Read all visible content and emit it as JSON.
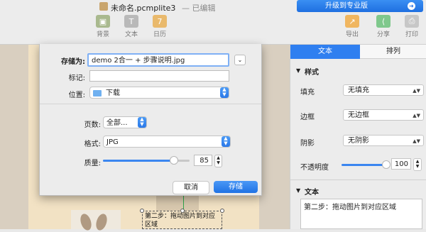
{
  "window": {
    "title": "未命名.pcmplite3",
    "edit_status": "— 已编辑",
    "upgrade_label": "升级到专业版"
  },
  "toolbar": {
    "left": [
      {
        "label": "背景",
        "icon": "background-icon"
      },
      {
        "label": "文本",
        "icon": "text-icon"
      },
      {
        "label": "日历",
        "icon": "calendar-icon"
      }
    ],
    "right": [
      {
        "label": "导出",
        "icon": "export-icon"
      },
      {
        "label": "分享",
        "icon": "share-icon"
      },
      {
        "label": "打印",
        "icon": "print-icon"
      }
    ]
  },
  "dialog": {
    "save_as_label": "存储为:",
    "save_as_value": "demo 2合一 + 步骤说明.jpg",
    "tags_label": "标记:",
    "location_label": "位置:",
    "location_value": "下载",
    "pages_label": "页数:",
    "pages_value": "全部...",
    "format_label": "格式:",
    "format_value": "JPG",
    "quality_label": "质量:",
    "quality_value": "85",
    "quality_level": 85,
    "cancel_label": "取消",
    "save_label": "存储"
  },
  "canvas": {
    "textbox": "第二步：拖动图片到对应区域"
  },
  "panel": {
    "tabs": [
      "文本",
      "排列"
    ],
    "active_tab": 0,
    "style_section": "样式",
    "fill_label": "填充",
    "fill_value": "无填充",
    "border_label": "边框",
    "border_value": "无边框",
    "shadow_label": "阴影",
    "shadow_value": "无阴影",
    "opacity_label": "不透明度",
    "opacity_value": "100",
    "text_section": "文本",
    "text_content": "第二步：拖动图片到对应区域"
  },
  "colors": {
    "accent": "#2f7ff0",
    "canvas": "#d9cfc0",
    "page": "#f2e2c4"
  }
}
